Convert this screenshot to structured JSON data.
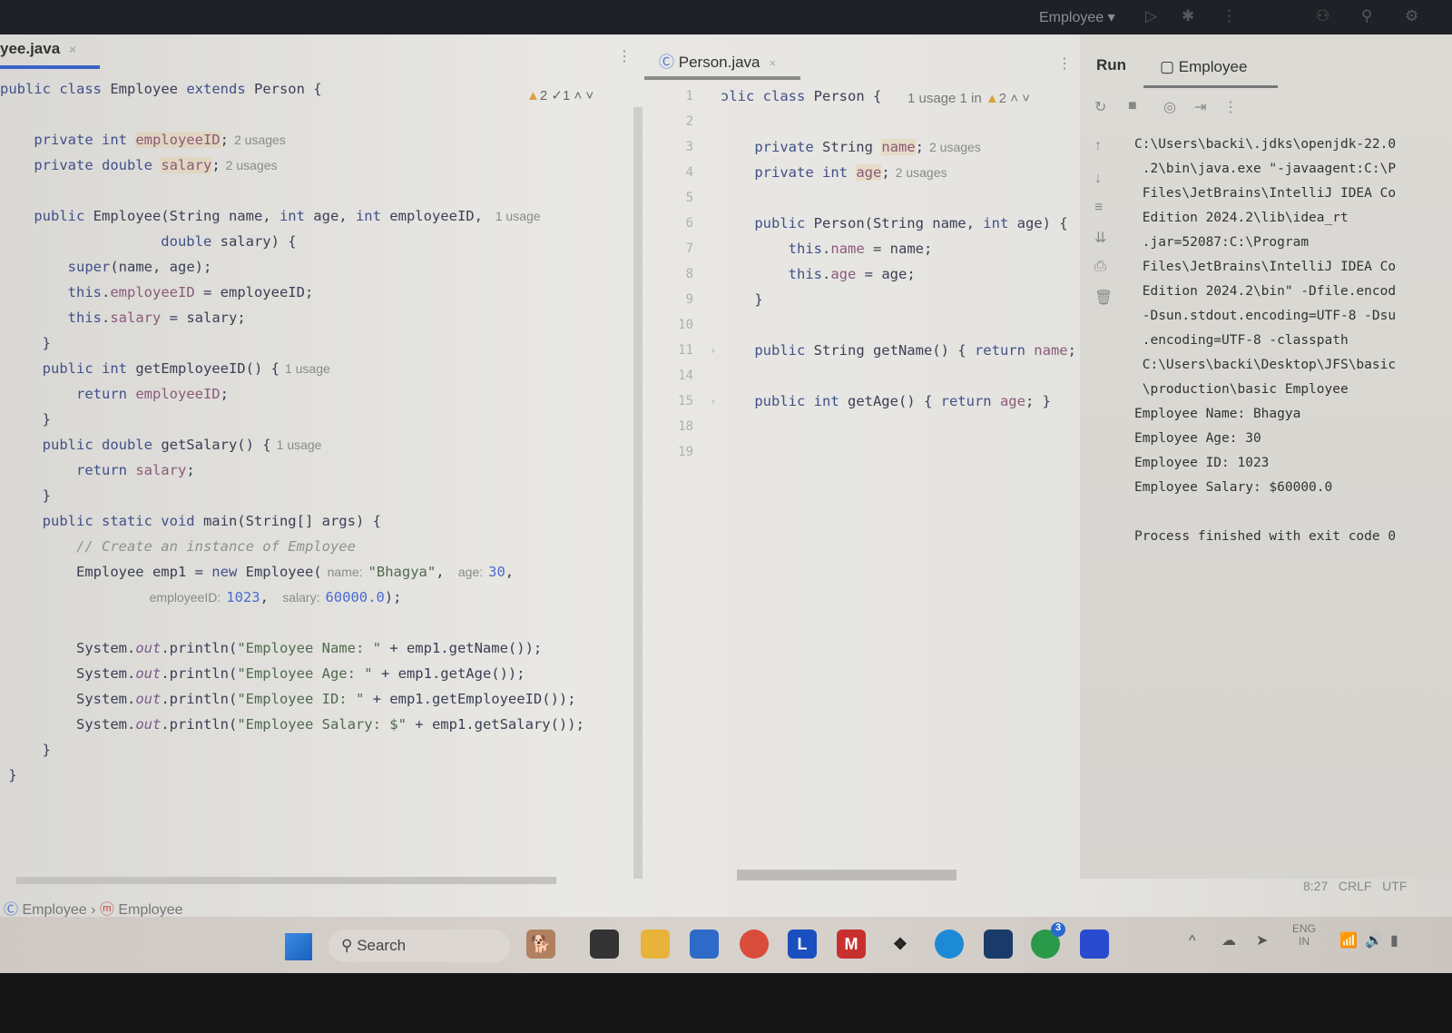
{
  "topbar": {
    "run_config": "Employee ▾"
  },
  "left_tab": {
    "label": "yee.java",
    "close": "×"
  },
  "left_status": {
    "warnings": "2",
    "checks": "1"
  },
  "left_editor": {
    "lines": [
      [
        {
          "t": "public class ",
          "c": "kw"
        },
        {
          "t": "Employee "
        },
        {
          "t": "extends ",
          "c": "kw"
        },
        {
          "t": "Person {"
        }
      ],
      [],
      [
        {
          "t": "    private int ",
          "c": "kw"
        },
        {
          "t": "employeeID",
          "c": "fld"
        },
        {
          "t": ";"
        },
        {
          "t": "2 usages",
          "c": "hint"
        }
      ],
      [
        {
          "t": "    private double ",
          "c": "kw"
        },
        {
          "t": "salary",
          "c": "fld"
        },
        {
          "t": ";"
        },
        {
          "t": "2 usages",
          "c": "hint"
        }
      ],
      [],
      [
        {
          "t": "    public ",
          "c": "kw"
        },
        {
          "t": "Employee(String name, "
        },
        {
          "t": "int ",
          "c": "kw"
        },
        {
          "t": "age, "
        },
        {
          "t": "int ",
          "c": "kw"
        },
        {
          "t": "employeeID,"
        },
        {
          "t": "  1 usage",
          "c": "hint"
        }
      ],
      [
        {
          "t": "                   double ",
          "c": "kw"
        },
        {
          "t": "salary) {"
        }
      ],
      [
        {
          "t": "        super",
          "c": "kw"
        },
        {
          "t": "(name, age);"
        }
      ],
      [
        {
          "t": "        this",
          "c": "kw"
        },
        {
          "t": "."
        },
        {
          "t": "employeeID",
          "c": "fl2"
        },
        {
          "t": " = employeeID;"
        }
      ],
      [
        {
          "t": "        this",
          "c": "kw"
        },
        {
          "t": "."
        },
        {
          "t": "salary",
          "c": "fl2"
        },
        {
          "t": " = salary;"
        }
      ],
      [
        {
          "t": "     }"
        }
      ],
      [
        {
          "t": "     public int ",
          "c": "kw"
        },
        {
          "t": "getEmployeeID() {"
        },
        {
          "t": "1 usage",
          "c": "hint"
        }
      ],
      [
        {
          "t": "         return ",
          "c": "kw"
        },
        {
          "t": "employeeID",
          "c": "fl2"
        },
        {
          "t": ";"
        }
      ],
      [
        {
          "t": "     }"
        }
      ],
      [
        {
          "t": "     public double ",
          "c": "kw"
        },
        {
          "t": "getSalary() {"
        },
        {
          "t": "1 usage",
          "c": "hint"
        }
      ],
      [
        {
          "t": "         return ",
          "c": "kw"
        },
        {
          "t": "salary",
          "c": "fl2"
        },
        {
          "t": ";"
        }
      ],
      [
        {
          "t": "     }"
        }
      ],
      [
        {
          "t": "     public static void ",
          "c": "kw"
        },
        {
          "t": "main(String[] args) {"
        }
      ],
      [
        {
          "t": "         // Create an instance of Employee",
          "c": "cm"
        }
      ],
      [
        {
          "t": "         Employee emp1 = "
        },
        {
          "t": "new ",
          "c": "kw"
        },
        {
          "t": "Employee("
        },
        {
          "t": "name:",
          "c": "hint"
        },
        {
          "t": "\"Bhagya\"",
          "c": "str"
        },
        {
          "t": ", "
        },
        {
          "t": "age:",
          "c": "hint"
        },
        {
          "t": "30",
          "c": "num"
        },
        {
          "t": ","
        }
      ],
      [
        {
          "t": "                 "
        },
        {
          "t": "employeeID:",
          "c": "hint"
        },
        {
          "t": "1023",
          "c": "num"
        },
        {
          "t": ", "
        },
        {
          "t": "salary:",
          "c": "hint"
        },
        {
          "t": "60000.0",
          "c": "num"
        },
        {
          "t": ");"
        }
      ],
      [],
      [
        {
          "t": "         System."
        },
        {
          "t": "out",
          "c": "it"
        },
        {
          "t": ".println("
        },
        {
          "t": "\"Employee Name: \"",
          "c": "str"
        },
        {
          "t": " + emp1.getName());"
        }
      ],
      [
        {
          "t": "         System."
        },
        {
          "t": "out",
          "c": "it"
        },
        {
          "t": ".println("
        },
        {
          "t": "\"Employee Age: \"",
          "c": "str"
        },
        {
          "t": " + emp1.getAge());"
        }
      ],
      [
        {
          "t": "         System."
        },
        {
          "t": "out",
          "c": "it"
        },
        {
          "t": ".println("
        },
        {
          "t": "\"Employee ID: \"",
          "c": "str"
        },
        {
          "t": " + emp1.getEmployeeID());"
        }
      ],
      [
        {
          "t": "         System."
        },
        {
          "t": "out",
          "c": "it"
        },
        {
          "t": ".println("
        },
        {
          "t": "\"Employee Salary: $\"",
          "c": "str"
        },
        {
          "t": " + emp1.getSalary());"
        }
      ],
      [
        {
          "t": "     }"
        }
      ],
      [
        {
          "t": " }"
        }
      ]
    ]
  },
  "right_tab": {
    "label": "Person.java",
    "close": "×"
  },
  "right_status": {
    "hint": "1 usage  1 in",
    "warnings": "2"
  },
  "right_editor": {
    "lines": [
      {
        "n": "1",
        "tokens": [
          {
            "t": "ɔlic class ",
            "c": "kw"
          },
          {
            "t": "Person {"
          }
        ]
      },
      {
        "n": "2",
        "tokens": []
      },
      {
        "n": "3",
        "tokens": [
          {
            "t": "    private ",
            "c": "kw"
          },
          {
            "t": "String "
          },
          {
            "t": "name",
            "c": "fld"
          },
          {
            "t": ";"
          },
          {
            "t": "2 usages",
            "c": "hint"
          }
        ]
      },
      {
        "n": "4",
        "tokens": [
          {
            "t": "    private int ",
            "c": "kw"
          },
          {
            "t": "age",
            "c": "fld"
          },
          {
            "t": ";"
          },
          {
            "t": "2 usages",
            "c": "hint"
          }
        ]
      },
      {
        "n": "5",
        "tokens": []
      },
      {
        "n": "6",
        "tokens": [
          {
            "t": "    public ",
            "c": "kw"
          },
          {
            "t": "Person(String name, "
          },
          {
            "t": "int ",
            "c": "kw"
          },
          {
            "t": "age) {"
          }
        ]
      },
      {
        "n": "7",
        "tokens": [
          {
            "t": "        this",
            "c": "kw"
          },
          {
            "t": "."
          },
          {
            "t": "name",
            "c": "fl2"
          },
          {
            "t": " = name;"
          }
        ]
      },
      {
        "n": "8",
        "tokens": [
          {
            "t": "        this",
            "c": "kw"
          },
          {
            "t": "."
          },
          {
            "t": "age",
            "c": "fl2"
          },
          {
            "t": " = age;"
          }
        ]
      },
      {
        "n": "9",
        "tokens": [
          {
            "t": "    }"
          }
        ]
      },
      {
        "n": "10",
        "tokens": []
      },
      {
        "n": "11",
        "fold": true,
        "tokens": [
          {
            "t": "    public ",
            "c": "kw"
          },
          {
            "t": "String getName() { "
          },
          {
            "t": "return ",
            "c": "kw"
          },
          {
            "t": "name",
            "c": "fl2"
          },
          {
            "t": ";"
          }
        ]
      },
      {
        "n": "14",
        "tokens": []
      },
      {
        "n": "15",
        "fold": true,
        "tokens": [
          {
            "t": "    public int ",
            "c": "kw"
          },
          {
            "t": "getAge() { "
          },
          {
            "t": "return ",
            "c": "kw"
          },
          {
            "t": "age",
            "c": "fl2"
          },
          {
            "t": "; }"
          }
        ]
      },
      {
        "n": "18",
        "tokens": []
      },
      {
        "n": "19",
        "tokens": []
      }
    ]
  },
  "run": {
    "title": "Run",
    "tab": "Employee",
    "output": [
      "C:\\Users\\backi\\.jdks\\openjdk-22.0",
      " .2\\bin\\java.exe \"-javaagent:C:\\P",
      " Files\\JetBrains\\IntelliJ IDEA Co",
      " Edition 2024.2\\lib\\idea_rt",
      " .jar=52087:C:\\Program",
      " Files\\JetBrains\\IntelliJ IDEA Co",
      " Edition 2024.2\\bin\" -Dfile.encod",
      " -Dsun.stdout.encoding=UTF-8 -Dsu",
      " .encoding=UTF-8 -classpath",
      " C:\\Users\\backi\\Desktop\\JFS\\basic",
      " \\production\\basic Employee",
      "Employee Name: Bhagya",
      "Employee Age: 30",
      "Employee ID: 1023",
      "Employee Salary: $60000.0",
      "",
      "Process finished with exit code 0"
    ]
  },
  "statusbar": {
    "position": "8:27",
    "line_sep": "CRLF",
    "encoding": "UTF"
  },
  "breadcrumb": [
    "Employee",
    "Employee"
  ],
  "taskbar": {
    "search": "Search",
    "lang": "ENG",
    "region": "IN",
    "whatsapp_badge": "3"
  }
}
